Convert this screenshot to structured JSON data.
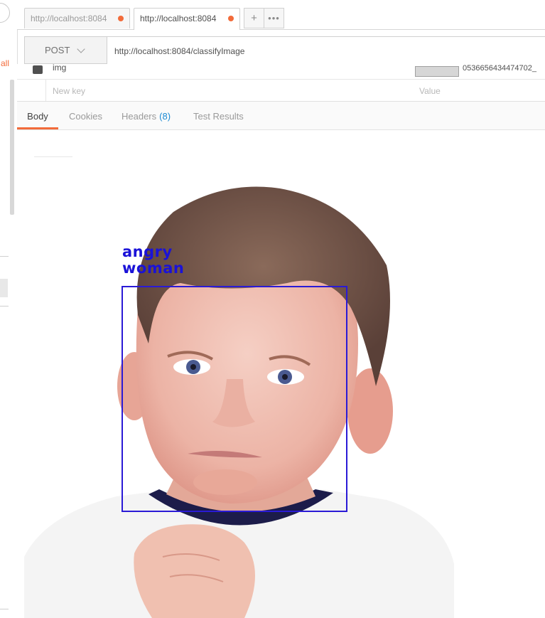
{
  "sidebar": {
    "all_label": "all"
  },
  "tabs": [
    {
      "title": "http://localhost:8084",
      "unsaved": true
    },
    {
      "title": "http://localhost:8084",
      "unsaved": true
    }
  ],
  "request": {
    "method": "POST",
    "url": "http://localhost:8084/classifyImage"
  },
  "params": {
    "row_key_partial": "img",
    "row_value_partial": "0536656434474702_",
    "new_key_placeholder": "New key",
    "new_value_placeholder": "Value"
  },
  "response_tabs": [
    {
      "label": "Body",
      "active": true
    },
    {
      "label": "Cookies"
    },
    {
      "label": "Headers",
      "count": "(8)"
    },
    {
      "label": "Test Results"
    }
  ],
  "detection": {
    "labels": [
      "angry",
      "woman"
    ],
    "box_color": "#2a1ad6"
  },
  "colors": {
    "accent": "#f26b3a",
    "link": "#1a8ad4"
  }
}
